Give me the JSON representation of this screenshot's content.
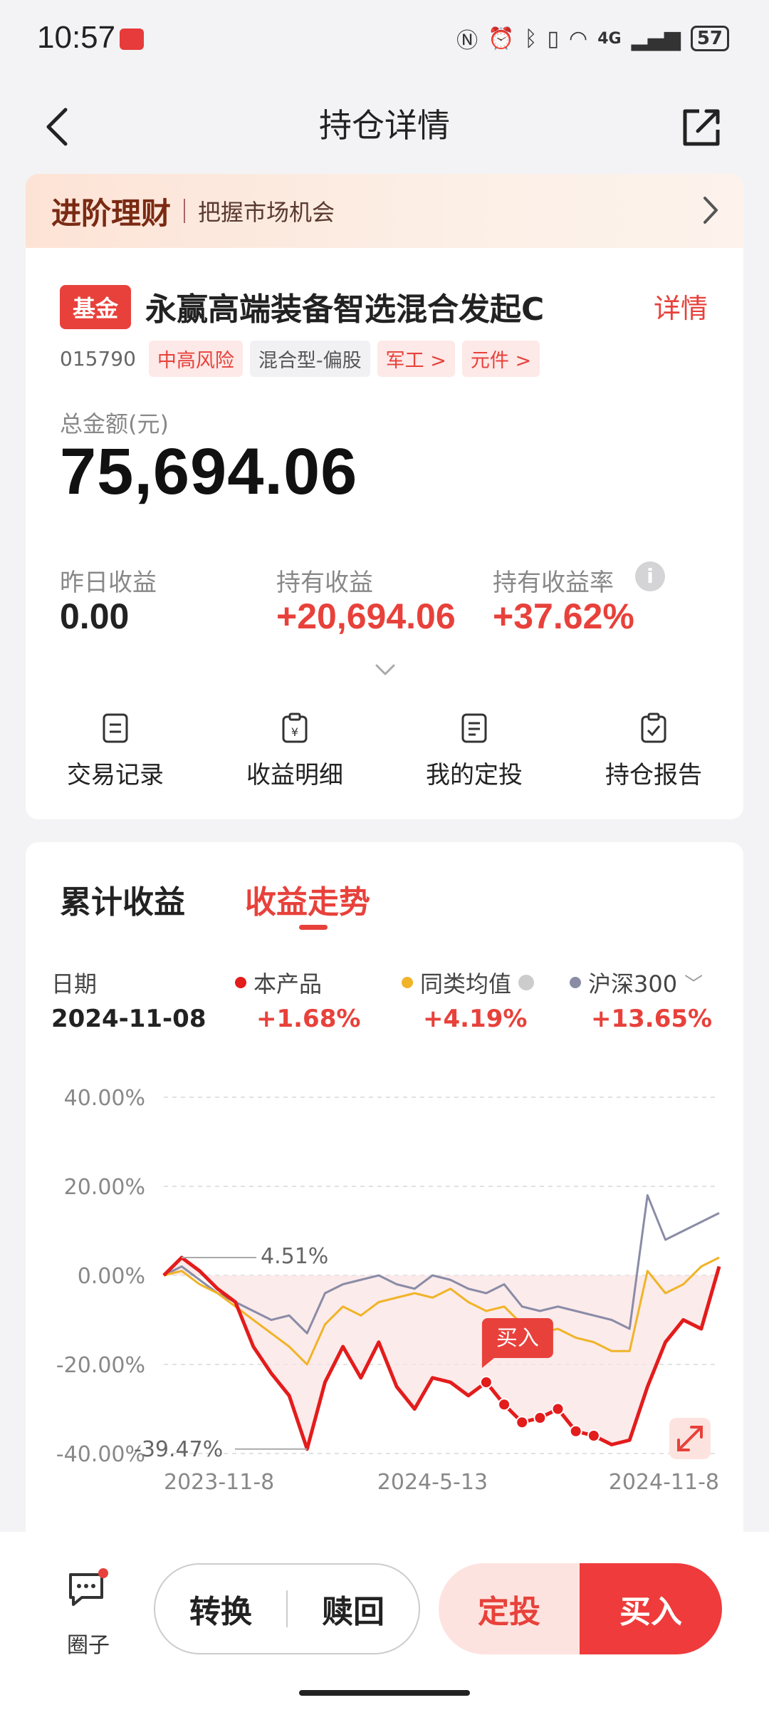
{
  "status_bar": {
    "time": "10:57",
    "battery": "57",
    "network": "4G"
  },
  "header": {
    "title": "持仓详情"
  },
  "promo": {
    "title": "进阶理财",
    "subtitle": "把握市场机会"
  },
  "fund": {
    "tag": "基金",
    "name": "永赢高端装备智选混合发起C",
    "detail_label": "详情",
    "code": "015790",
    "chips": [
      "中高风险",
      "混合型-偏股",
      "军工 >",
      "元件 >"
    ],
    "total_label": "总金额(元)",
    "total_value": "75,694.06",
    "stats": {
      "yesterday_label": "昨日收益",
      "yesterday_value": "0.00",
      "holding_label": "持有收益",
      "holding_value": "+20,694.06",
      "rate_label": "持有收益率",
      "rate_value": "+37.62%"
    },
    "actions": [
      "交易记录",
      "收益明细",
      "我的定投",
      "持仓报告"
    ]
  },
  "chart_section": {
    "tabs": [
      "累计收益",
      "收益走势"
    ],
    "date_label": "日期",
    "date_value": "2024-11-08",
    "legend": [
      {
        "name": "本产品",
        "value": "+1.68%",
        "color": "#e31c1c"
      },
      {
        "name": "同类均值",
        "value": "+4.19%",
        "color": "#f0b429"
      },
      {
        "name": "沪深300",
        "value": "+13.65%",
        "color": "#8a8ca6"
      }
    ]
  },
  "chart_data": {
    "type": "line",
    "ylim": [
      -40,
      40
    ],
    "yticks": [
      "40.00%",
      "20.00%",
      "0.00%",
      "-20.00%",
      "-40.00%"
    ],
    "xticks": [
      "2023-11-8",
      "2024-5-13",
      "2024-11-8"
    ],
    "annotations": {
      "max_label": "4.51%",
      "min_label": "-39.47%",
      "buy_label": "买入"
    },
    "series": [
      {
        "name": "本产品",
        "color": "#e31c1c",
        "values": [
          0,
          4,
          1,
          -3,
          -6,
          -16,
          -22,
          -27,
          -39,
          -24,
          -16,
          -23,
          -15,
          -25,
          -30,
          -23,
          -24,
          -27,
          -24,
          -29,
          -33,
          -32,
          -30,
          -35,
          -36,
          -38,
          -37,
          -25,
          -15,
          -10,
          -12,
          2
        ]
      },
      {
        "name": "同类均值",
        "color": "#f0b429",
        "values": [
          0,
          1,
          -2,
          -4,
          -7,
          -10,
          -13,
          -16,
          -20,
          -11,
          -7,
          -9,
          -6,
          -5,
          -4,
          -5,
          -3,
          -6,
          -8,
          -7,
          -11,
          -13,
          -12,
          -14,
          -15,
          -17,
          -17,
          1,
          -4,
          -2,
          2,
          4
        ]
      },
      {
        "name": "沪深300",
        "color": "#8a8ca6",
        "values": [
          0,
          2,
          -1,
          -4,
          -6,
          -8,
          -10,
          -9,
          -13,
          -4,
          -2,
          -1,
          0,
          -2,
          -3,
          0,
          -1,
          -3,
          -4,
          -2,
          -7,
          -8,
          -7,
          -8,
          -9,
          -10,
          -12,
          18,
          8,
          10,
          12,
          14
        ]
      }
    ],
    "buy_markers": [
      18,
      19,
      20,
      21,
      22,
      23,
      24
    ]
  },
  "bottom_bar": {
    "circle_label": "圈子",
    "convert_label": "转换",
    "redeem_label": "赎回",
    "sip_label": "定投",
    "buy_label": "买入"
  }
}
